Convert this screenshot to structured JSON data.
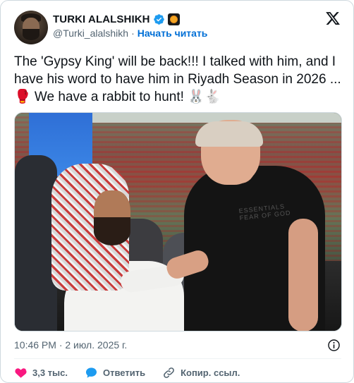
{
  "author": {
    "name": "TURKI ALALSHIKH",
    "handle": "@Turki_alalshikh",
    "separator": "·",
    "follow_label": "Начать читать",
    "avatar": "avatar-photo",
    "verified_icon": "verified-badge-icon",
    "affiliate_icon": "affiliation-badge-icon"
  },
  "platform_icon": "x-logo-icon",
  "tweet": {
    "text": "The 'Gypsy King' will be back!!! I talked with him, and I have his word to have him in Riyadh Season in 2026 ... 🥊 We have a rabbit to hunt! 🐰🐇"
  },
  "media": {
    "kind": "photo",
    "shirt_text": "ESSENTIALS FEAR OF GOD"
  },
  "meta": {
    "timestamp": "10:46 PM · 2 июл. 2025 г.",
    "info_icon": "info-icon"
  },
  "actions": {
    "like_count": "3,3 тыс.",
    "reply_label": "Ответить",
    "copy_link_label": "Копир. ссыл."
  },
  "colors": {
    "verified": "#1d9bf0",
    "like": "#f91880",
    "reply": "#1d9bf0",
    "link_text": "#006fd6",
    "secondary_text": "#536471"
  }
}
